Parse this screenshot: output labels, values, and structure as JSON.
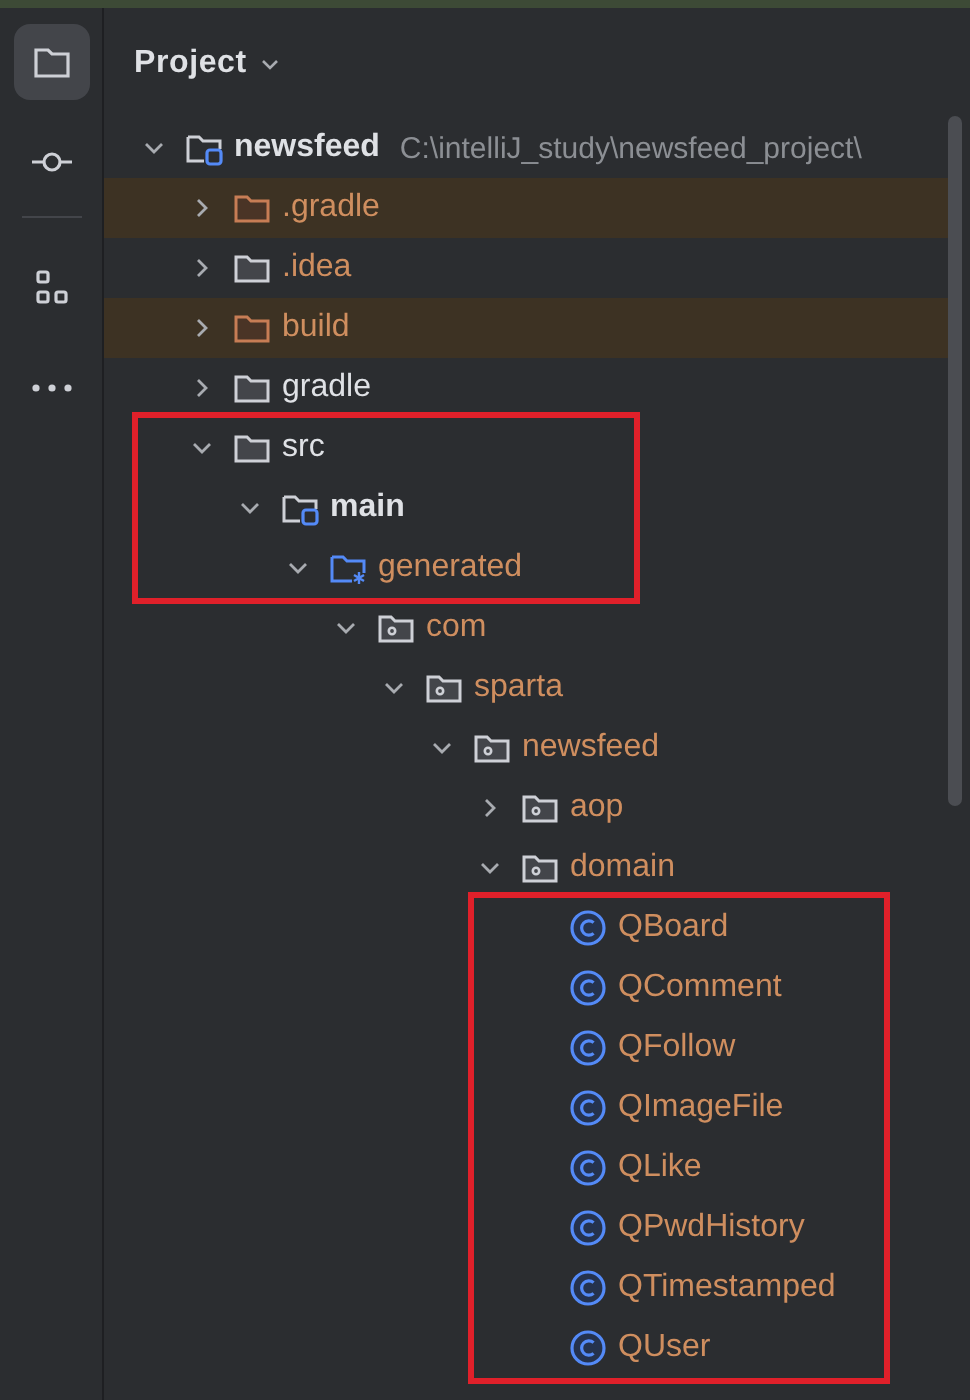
{
  "sidebar": {
    "items": [
      {
        "kind": "project",
        "selected": true
      },
      {
        "kind": "commit",
        "selected": false
      },
      {
        "kind": "structure",
        "selected": false
      },
      {
        "kind": "more",
        "selected": false
      }
    ]
  },
  "panel": {
    "title": "Project",
    "tree": [
      {
        "label": "newsfeed",
        "path": "C:\\intelliJ_study\\newsfeed_project\\",
        "kind": "module",
        "expanded": true,
        "boxed": false,
        "children": [
          {
            "label": ".gradle",
            "kind": "excluded",
            "expanded": false,
            "boxed": false
          },
          {
            "label": ".idea",
            "kind": "ignored",
            "expanded": false,
            "boxed": false
          },
          {
            "label": "build",
            "kind": "excluded",
            "expanded": false,
            "boxed": false
          },
          {
            "label": "gradle",
            "kind": "folder",
            "expanded": false,
            "boxed": false
          },
          {
            "label": "src",
            "kind": "folder",
            "expanded": true,
            "boxed": true,
            "children": [
              {
                "label": "main",
                "kind": "module",
                "expanded": true,
                "boxed": true,
                "children": [
                  {
                    "label": "generated",
                    "kind": "generated",
                    "expanded": true,
                    "boxed": true,
                    "children": [
                      {
                        "label": "com",
                        "kind": "package",
                        "expanded": true,
                        "boxed": false,
                        "children": [
                          {
                            "label": "sparta",
                            "kind": "package",
                            "expanded": true,
                            "boxed": false,
                            "children": [
                              {
                                "label": "newsfeed",
                                "kind": "package",
                                "expanded": true,
                                "boxed": false,
                                "children": [
                                  {
                                    "label": "aop",
                                    "kind": "package",
                                    "expanded": false,
                                    "boxed": false
                                  },
                                  {
                                    "label": "domain",
                                    "kind": "package",
                                    "expanded": true,
                                    "boxed": false,
                                    "children": [
                                      {
                                        "label": "QBoard",
                                        "kind": "class",
                                        "boxed": true
                                      },
                                      {
                                        "label": "QComment",
                                        "kind": "class",
                                        "boxed": true
                                      },
                                      {
                                        "label": "QFollow",
                                        "kind": "class",
                                        "boxed": true
                                      },
                                      {
                                        "label": "QImageFile",
                                        "kind": "class",
                                        "boxed": true
                                      },
                                      {
                                        "label": "QLike",
                                        "kind": "class",
                                        "boxed": true
                                      },
                                      {
                                        "label": "QPwdHistory",
                                        "kind": "class",
                                        "boxed": true
                                      },
                                      {
                                        "label": "QTimestamped",
                                        "kind": "class",
                                        "boxed": true
                                      },
                                      {
                                        "label": "QUser",
                                        "kind": "class",
                                        "boxed": true
                                      }
                                    ]
                                  }
                                ]
                              }
                            ]
                          }
                        ]
                      }
                    ]
                  }
                ]
              }
            ]
          }
        ]
      }
    ]
  }
}
